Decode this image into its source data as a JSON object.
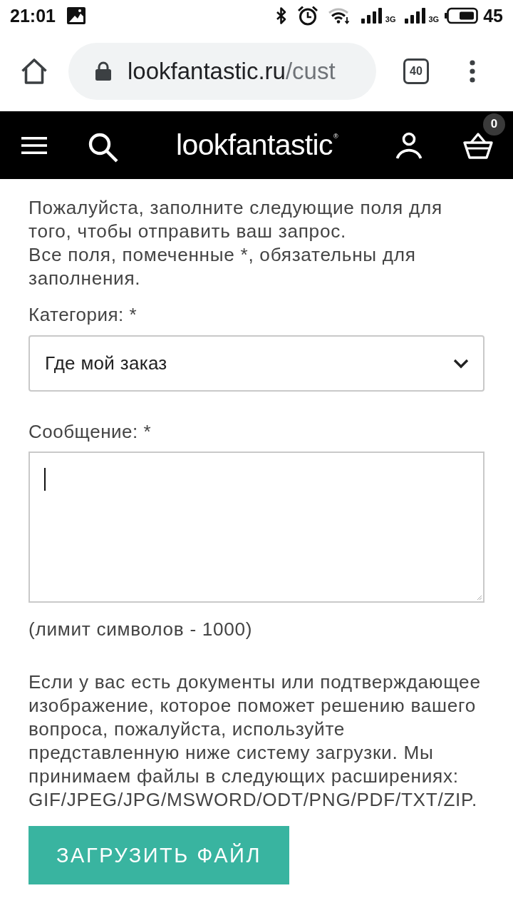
{
  "status_bar": {
    "time": "21:01",
    "signals": [
      {
        "network": "3G"
      },
      {
        "network": "3G"
      }
    ],
    "battery": "45"
  },
  "browser": {
    "url": {
      "host": "lookfantastic.ru",
      "path": "/cust"
    },
    "tab_count": "40"
  },
  "site_header": {
    "logo": "lookfantastic$^{®}$",
    "cart_count": "0"
  },
  "form": {
    "intro": [
      "Пожалуйста, заполните следующие поля для того, чтобы отправить ваш запрос.",
      "Все поля, помеченные *, обязательны для заполнения."
    ],
    "category": {
      "label": "Категория: *",
      "value": "Где мой заказ"
    },
    "message": {
      "label": "Сообщение: *",
      "focused": true,
      "hint": "(лимит символов - 1000)"
    },
    "upload_note": "Если у вас есть документы или подтверждающее изображение, которое поможет решению вашего вопроса, пожалуйста, используйте представленную ниже систему загрузки. Мы принимаем файлы в следующих расширениях: GIF/JPEG/JPG/MSWORD/ODT/PNG/PDF/TXT/ZIP.",
    "upload_button": "ЗАГРУЗИТЬ ФАЙЛ"
  }
}
